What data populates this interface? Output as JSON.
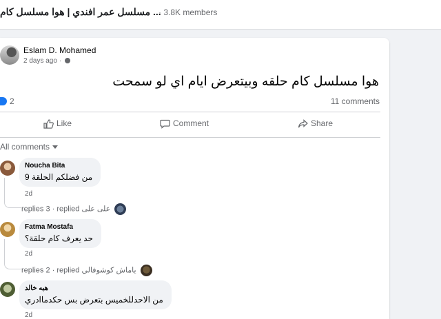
{
  "group": {
    "title": "مسلسل عمر افندي | هوا مسلسل كام ...",
    "members": "· 3.8K members"
  },
  "post": {
    "author": "Eslam D. Mohamed",
    "time": "2 days ago ·",
    "text": "هوا مسلسل كام حلقه وبيتعرض ايام اي لو سمحت",
    "likes": "2",
    "comments_count": "11 comments"
  },
  "actions": {
    "like": "Like",
    "comment": "Comment",
    "share": "Share"
  },
  "comments_filter": "All comments",
  "comments": [
    {
      "name": "Noucha Bita",
      "text": "من فضلكم الحلقة 9",
      "time": "2d",
      "replies": "replies 3 · replied",
      "replier": "على على"
    },
    {
      "name": "Fatma Mostafa",
      "text": "حد يعرف كام حلقة؟",
      "time": "2d",
      "replies": "replies 2 · replied",
      "replier": "ياماش كوشوفالي"
    },
    {
      "name": "هبه خالد",
      "text": "من الاحدللخميس بتعرض بس حكدماادري",
      "time": "2d"
    }
  ],
  "colors": {
    "accent": "#1877f2",
    "muted_text": "#65676b",
    "bubble": "#f0f2f5"
  },
  "icons": [
    "globe-icon",
    "like-icon",
    "thumb-up-icon",
    "comment-icon",
    "share-icon",
    "caret-down-icon"
  ]
}
